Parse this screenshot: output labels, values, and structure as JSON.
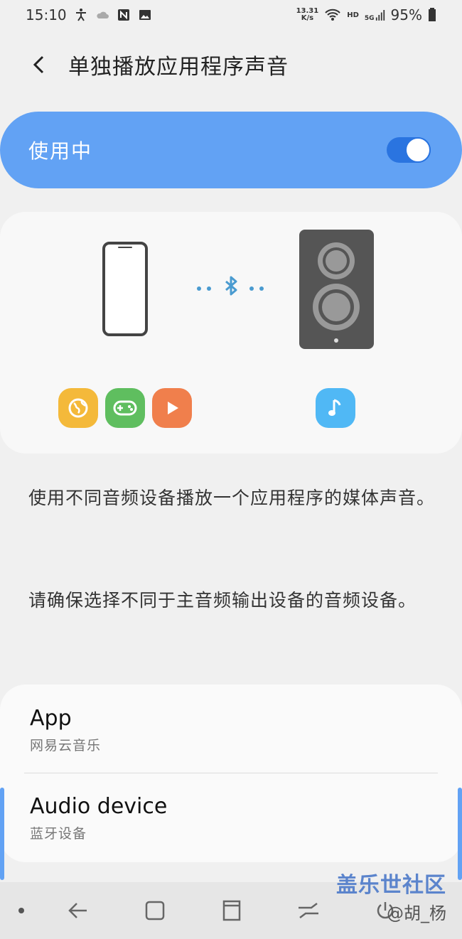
{
  "status_bar": {
    "time": "15:10",
    "net_speed_value": "13.31",
    "net_speed_unit": "K/s",
    "hd": "HD",
    "network": "5G",
    "battery": "95%",
    "icons": [
      "accessibility-icon",
      "cloud-icon",
      "nfc-icon",
      "gallery-icon",
      "wifi-icon",
      "signal-icon",
      "battery-icon"
    ]
  },
  "header": {
    "title": "单独播放应用程序声音"
  },
  "master_switch": {
    "label": "使用中",
    "on": true
  },
  "illustration": {
    "app_icons": [
      "browser-icon",
      "game-icon",
      "video-icon"
    ],
    "music_icon": "music-note-icon",
    "colors": {
      "browser": "#f4b93a",
      "game": "#5fbe5f",
      "video": "#f07f4c",
      "music": "#50b8f5",
      "speaker": "#555555",
      "bluetooth": "#4a9bd0"
    }
  },
  "description": {
    "line1": "使用不同音频设备播放一个应用程序的媒体声音。",
    "line2": "请确保选择不同于主音频输出设备的音频设备。"
  },
  "settings": {
    "items": [
      {
        "title": "App",
        "value": "网易云音乐"
      },
      {
        "title": "Audio device",
        "value": "蓝牙设备"
      }
    ]
  },
  "watermark": {
    "line1": "盖乐世社区",
    "line2": "@胡_杨"
  },
  "accent_color": "#62a2f4"
}
